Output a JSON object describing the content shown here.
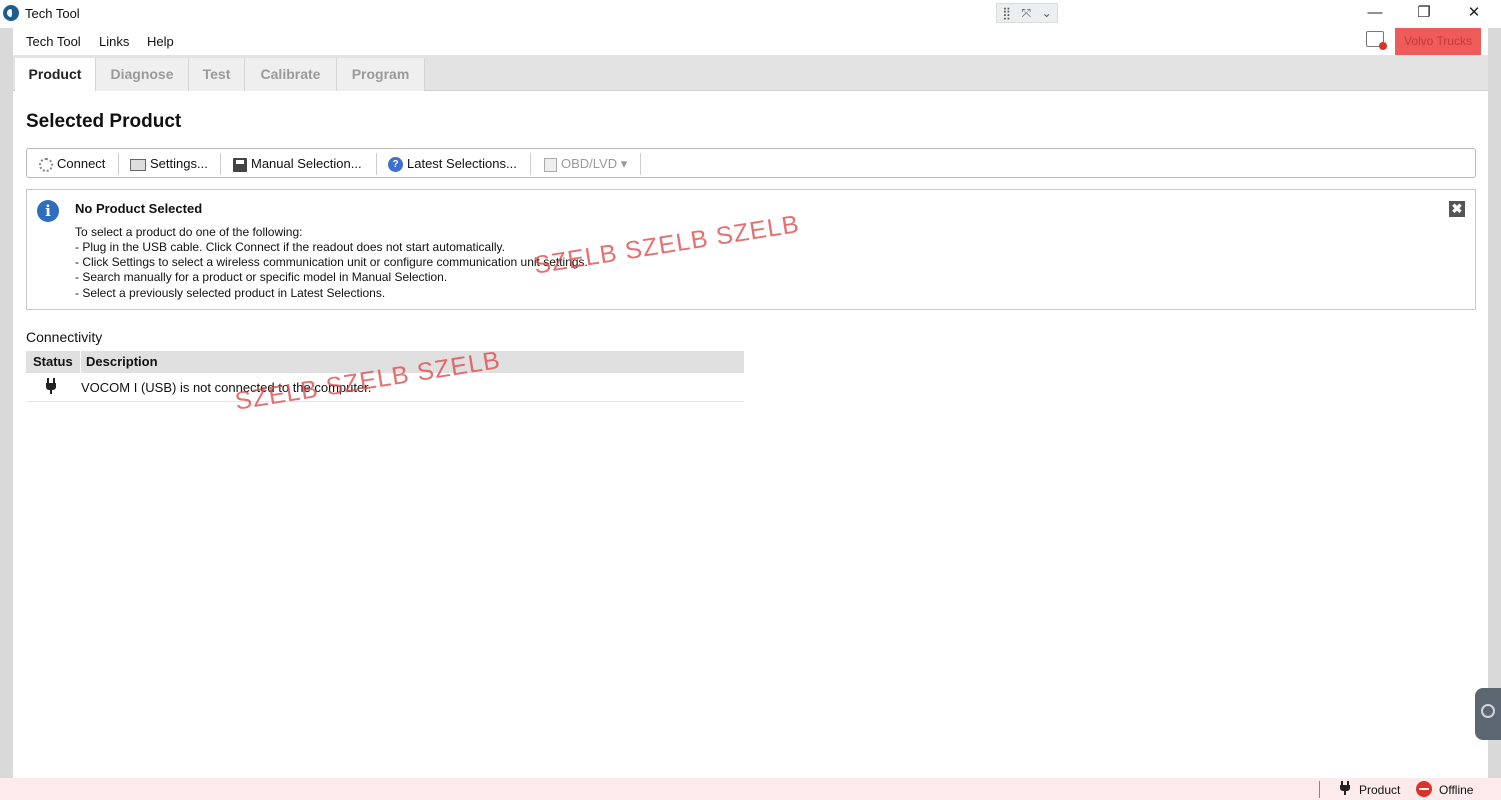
{
  "window": {
    "title": "Tech Tool",
    "snap_icons": [
      "⣿",
      "⤧",
      "⌄"
    ],
    "minimize": "—",
    "restore": "❐",
    "close": "✕"
  },
  "menu": {
    "items": [
      {
        "label": "Tech Tool"
      },
      {
        "label": "Links"
      },
      {
        "label": "Help"
      }
    ],
    "brand_label": "Volvo Trucks"
  },
  "tabs": [
    {
      "label": "Product",
      "active": true
    },
    {
      "label": "Diagnose",
      "active": false
    },
    {
      "label": "Test",
      "active": false
    },
    {
      "label": "Calibrate",
      "active": false
    },
    {
      "label": "Program",
      "active": false
    }
  ],
  "page": {
    "title": "Selected Product"
  },
  "toolbar": {
    "connect": "Connect",
    "settings": "Settings...",
    "manual": "Manual Selection...",
    "latest": "Latest Selections...",
    "latest_icon": "?",
    "obd": "OBD/LVD",
    "obd_arrow": "▾"
  },
  "info": {
    "icon": "i",
    "title": "No Product Selected",
    "close": "✖",
    "lines": [
      "To select a product do one of the following:",
      "- Plug in the USB cable. Click Connect if the readout does not start automatically.",
      "- Click Settings to select a wireless communication unit or configure communication unit settings.",
      "- Search manually for a product or specific model in Manual Selection.",
      "- Select a previously selected product in Latest Selections."
    ]
  },
  "connectivity": {
    "title": "Connectivity",
    "headers": [
      "Status",
      "Description"
    ],
    "rows": [
      {
        "status_icon": "plug-icon",
        "description": "VOCOM I (USB) is not connected to the computer."
      }
    ]
  },
  "watermarks": [
    "SZELB SZELB SZELB",
    "SZELB SZELB SZELB"
  ],
  "statusbar": {
    "product": "Product",
    "offline": "Offline"
  },
  "colors": {
    "brand": "#ef5b5b",
    "offline": "#e0302c",
    "watermark": "#e04848",
    "statusbar_bg": "#fdeaea"
  }
}
